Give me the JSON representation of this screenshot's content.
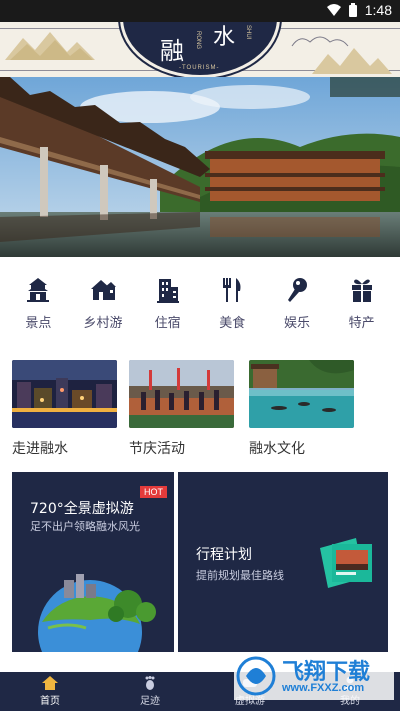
{
  "status_bar": {
    "time": "1:48"
  },
  "header": {
    "logo_char_1": "融",
    "logo_char_2": "水",
    "logo_tourism": "-TOURISM-",
    "logo_side_1": "RONG",
    "logo_side_2": "SHUI"
  },
  "categories": [
    {
      "label": "景点",
      "icon": "pagoda-icon"
    },
    {
      "label": "乡村游",
      "icon": "village-house-icon"
    },
    {
      "label": "住宿",
      "icon": "hotel-building-icon"
    },
    {
      "label": "美食",
      "icon": "fork-knife-icon"
    },
    {
      "label": "娱乐",
      "icon": "microphone-icon"
    },
    {
      "label": "特产",
      "icon": "gift-icon"
    }
  ],
  "features": [
    {
      "label": "走进融水"
    },
    {
      "label": "节庆活动"
    },
    {
      "label": "融水文化"
    }
  ],
  "vr_card": {
    "title": "720°全景虚拟游",
    "subtitle": "足不出户领略融水风光",
    "badge": "HOT"
  },
  "plan_card": {
    "title": "行程计划",
    "subtitle": "提前规划最佳路线"
  },
  "bottom_nav": [
    {
      "label": "首页",
      "icon": "home-icon",
      "active": true
    },
    {
      "label": "足迹",
      "icon": "footprint-icon",
      "active": false
    },
    {
      "label": "虚拟游",
      "icon": "vr-icon",
      "active": false
    },
    {
      "label": "我的",
      "icon": "user-icon",
      "active": false
    }
  ],
  "watermark": {
    "brand": "飞翔下载",
    "url": "www.FXXZ.com"
  },
  "colors": {
    "navy": "#1f2845",
    "banner_bg": "#f3efe6",
    "hot_red": "#e43b3b",
    "watermark_blue": "#1f7fd6"
  }
}
